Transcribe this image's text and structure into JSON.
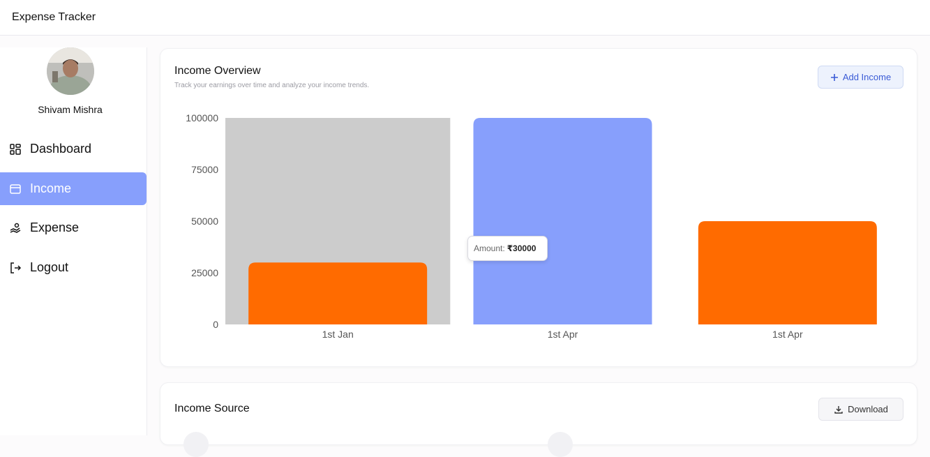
{
  "app": {
    "title": "Expense Tracker"
  },
  "user": {
    "name": "Shivam Mishra"
  },
  "sidebar": {
    "items": [
      {
        "label": "Dashboard",
        "icon": "dashboard-icon",
        "active": false
      },
      {
        "label": "Income",
        "icon": "wallet-icon",
        "active": true
      },
      {
        "label": "Expense",
        "icon": "hand-coins-icon",
        "active": false
      },
      {
        "label": "Logout",
        "icon": "logout-icon",
        "active": false
      }
    ],
    "active_color": "#879ffc"
  },
  "overview": {
    "title": "Income Overview",
    "subtitle": "Track your earnings over time and analyze your income trends.",
    "add_button": "Add Income"
  },
  "chart_data": {
    "type": "bar",
    "categories": [
      "1st Jan",
      "1st Apr",
      "1st Apr"
    ],
    "values": [
      30000,
      100000,
      50000
    ],
    "ylim": [
      0,
      100000
    ],
    "yticks": [
      "0",
      "25000",
      "50000",
      "75000",
      "100000"
    ],
    "colors": [
      "#ff6b00",
      "#879ffc",
      "#ff6b00"
    ],
    "hovered_index": 0,
    "grid": false,
    "tooltip": {
      "label": "Amount:",
      "value": "₹30000"
    }
  },
  "source": {
    "title": "Income Source",
    "download_button": "Download"
  }
}
